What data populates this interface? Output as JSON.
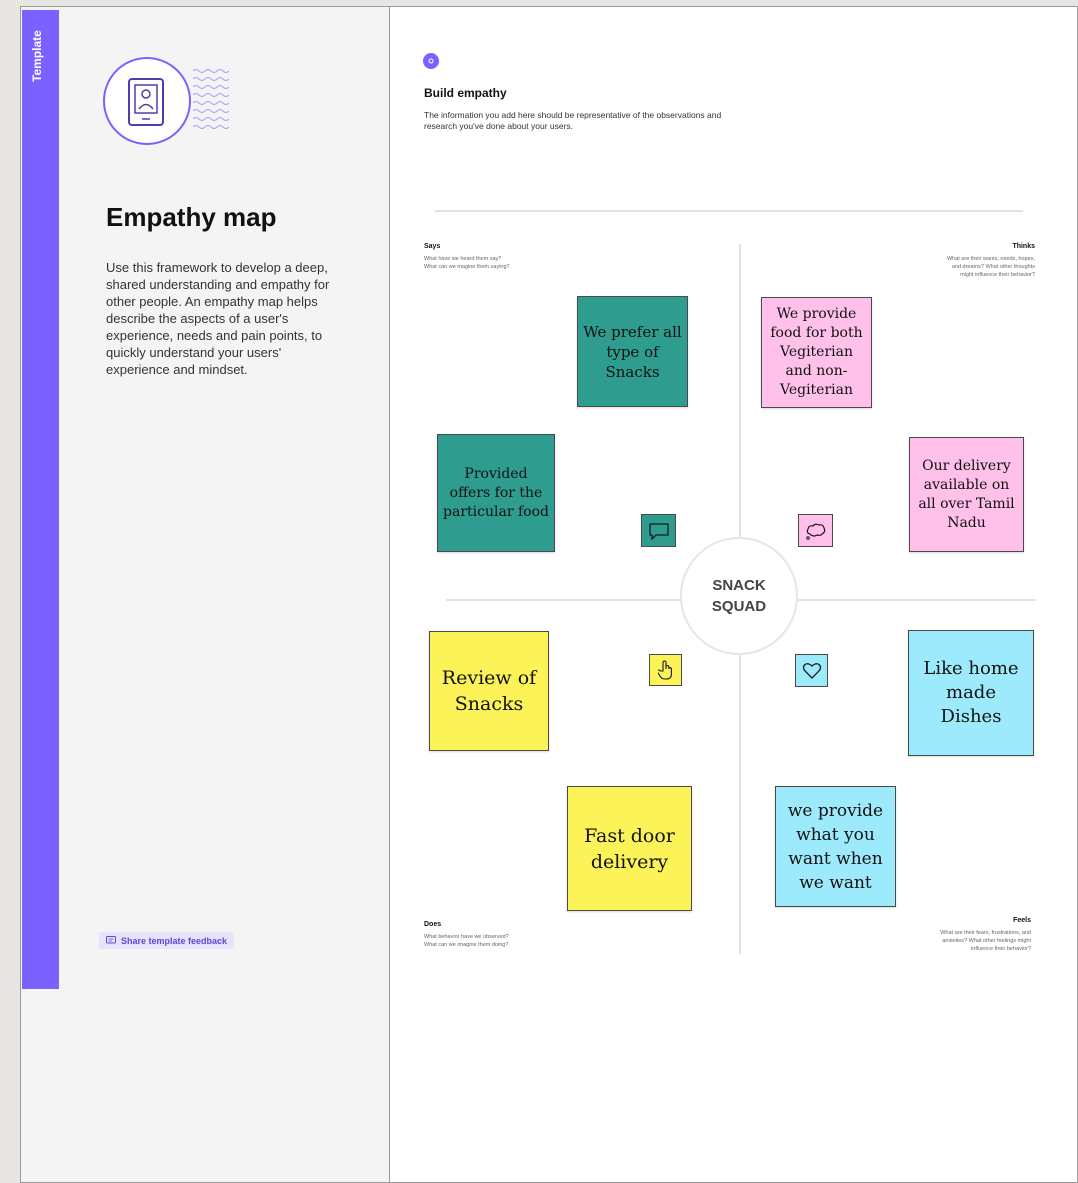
{
  "template_tab": "Template",
  "left": {
    "title": "Empathy map",
    "description": "Use this framework to develop a deep, shared understanding and empathy for other people. An empathy map helps describe the aspects of a user's experience, needs and pain points, to quickly understand your users' experience and mindset.",
    "feedback_label": "Share template feedback"
  },
  "canvas": {
    "build_title": "Build empathy",
    "build_desc": "The information you add here should be representative of the observations and research you've done about your users.",
    "center_line1": "SNACK",
    "center_line2": "SQUAD",
    "quadrants": {
      "says": {
        "title": "Says",
        "line1": "What have we heard them say?",
        "line2": "What can we magine them saying?"
      },
      "thinks": {
        "title": "Thinks",
        "line1": "What are their wants, needs, hopes,",
        "line2": "and dreams? What other thoughts",
        "line3": "might influence their behavior?"
      },
      "does": {
        "title": "Does",
        "line1": "What behavior have we observed?",
        "line2": "What can we imagine them doing?"
      },
      "feels": {
        "title": "Feels",
        "line1": "What are their fears, frustrations, and",
        "line2": "anxieties? What other feelings might",
        "line3": "influence their behavior?"
      }
    },
    "notes": {
      "snacks_pref": "We prefer all type of Snacks",
      "offers": "Provided offers for the particular food",
      "veg": "We provide food for both Vegiterian and non-Vegiterian",
      "delivery_area": "Our delivery available on all over Tamil Nadu",
      "review": "Review of Snacks",
      "fast_delivery": "Fast door delivery",
      "home_dishes": "Like home made Dishes",
      "provide_want": "we provide what you want when we want"
    },
    "icons": {
      "says": "speech-bubble-icon",
      "thinks": "thought-bubble-icon",
      "does": "pointer-hand-icon",
      "feels": "heart-icon"
    }
  },
  "colors": {
    "accent": "#7b61ff",
    "teal_note": "#2e9c8f",
    "pink_note": "#ffc0ea",
    "yellow_note": "#fbf358",
    "cyan_note": "#9ceafb"
  }
}
